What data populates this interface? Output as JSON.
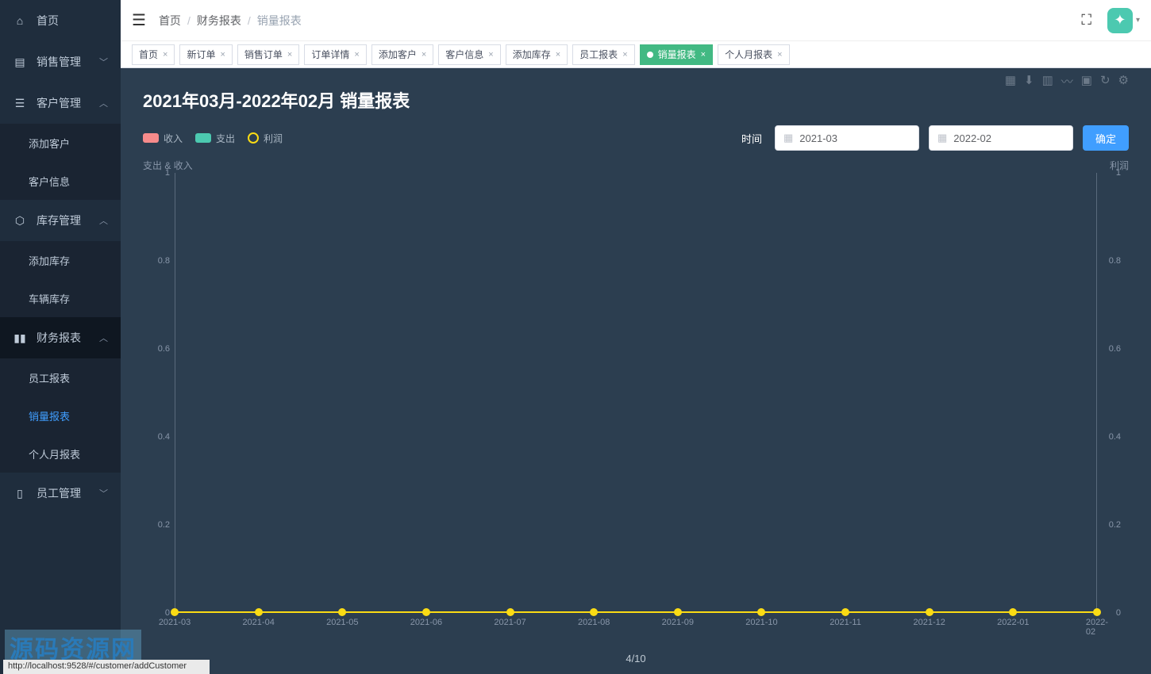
{
  "sidebar": {
    "items": [
      {
        "icon": "dashboard",
        "label": "首页",
        "expandable": false
      },
      {
        "icon": "sales",
        "label": "销售管理",
        "expandable": true,
        "open": false
      },
      {
        "icon": "customer",
        "label": "客户管理",
        "expandable": true,
        "open": true,
        "children": [
          {
            "label": "添加客户"
          },
          {
            "label": "客户信息"
          }
        ]
      },
      {
        "icon": "stock",
        "label": "库存管理",
        "expandable": true,
        "open": true,
        "children": [
          {
            "label": "添加库存"
          },
          {
            "label": "车辆库存"
          }
        ]
      },
      {
        "icon": "finance",
        "label": "财务报表",
        "expandable": true,
        "open": true,
        "active_section": true,
        "children": [
          {
            "label": "员工报表"
          },
          {
            "label": "销量报表",
            "active": true
          },
          {
            "label": "个人月报表"
          }
        ]
      },
      {
        "icon": "staff",
        "label": "员工管理",
        "expandable": true,
        "open": false
      }
    ]
  },
  "breadcrumb": {
    "home": "首页",
    "section": "财务报表",
    "page": "销量报表"
  },
  "tabs": [
    {
      "label": "首页",
      "closable": true
    },
    {
      "label": "新订单",
      "closable": true
    },
    {
      "label": "销售订单",
      "closable": true
    },
    {
      "label": "订单详情",
      "closable": true
    },
    {
      "label": "添加客户",
      "closable": true
    },
    {
      "label": "客户信息",
      "closable": true
    },
    {
      "label": "添加库存",
      "closable": true
    },
    {
      "label": "员工报表",
      "closable": true
    },
    {
      "label": "销量报表",
      "closable": true,
      "active": true
    },
    {
      "label": "个人月报表",
      "closable": true
    }
  ],
  "page": {
    "title": "2021年03月-2022年02月 销量报表",
    "time_label": "时间",
    "date_start": "2021-03",
    "date_end": "2022-02",
    "confirm": "确定",
    "pager": "4/10"
  },
  "legend": {
    "income": {
      "label": "收入",
      "color": "#f78b8b"
    },
    "expense": {
      "label": "支出",
      "color": "#4cc9b0"
    },
    "profit": {
      "label": "利润",
      "color": "#fadb14"
    }
  },
  "toolbarIcons": [
    "data-view",
    "save-image",
    "bar-chart",
    "line-chart",
    "stack",
    "restore",
    "settings"
  ],
  "chart_data": {
    "type": "line",
    "title": "2021年03月-2022年02月 销量报表",
    "y_left_title": "支出 & 收入",
    "y_right_title": "利润",
    "categories": [
      "2021-03",
      "2021-04",
      "2021-05",
      "2021-06",
      "2021-07",
      "2021-08",
      "2021-09",
      "2021-10",
      "2021-11",
      "2021-12",
      "2022-01",
      "2022-02"
    ],
    "series": [
      {
        "name": "收入",
        "axis": "left",
        "values": [
          0,
          0,
          0,
          0,
          0,
          0,
          0,
          0,
          0,
          0,
          0,
          0
        ]
      },
      {
        "name": "支出",
        "axis": "left",
        "values": [
          0,
          0,
          0,
          0,
          0,
          0,
          0,
          0,
          0,
          0,
          0,
          0
        ]
      },
      {
        "name": "利润",
        "axis": "right",
        "values": [
          0,
          0,
          0,
          0,
          0,
          0,
          0,
          0,
          0,
          0,
          0,
          0
        ]
      }
    ],
    "y_left": {
      "min": 0,
      "max": 1,
      "ticks": [
        0,
        0.2,
        0.4,
        0.6,
        0.8,
        1
      ]
    },
    "y_right": {
      "min": 0,
      "max": 1,
      "ticks": [
        0,
        0.2,
        0.4,
        0.6,
        0.8,
        1
      ]
    }
  },
  "watermark": {
    "text": "源码资源网",
    "url": "http://www.neti88.com"
  },
  "status_url": "http://localhost:9528/#/customer/addCustomer"
}
